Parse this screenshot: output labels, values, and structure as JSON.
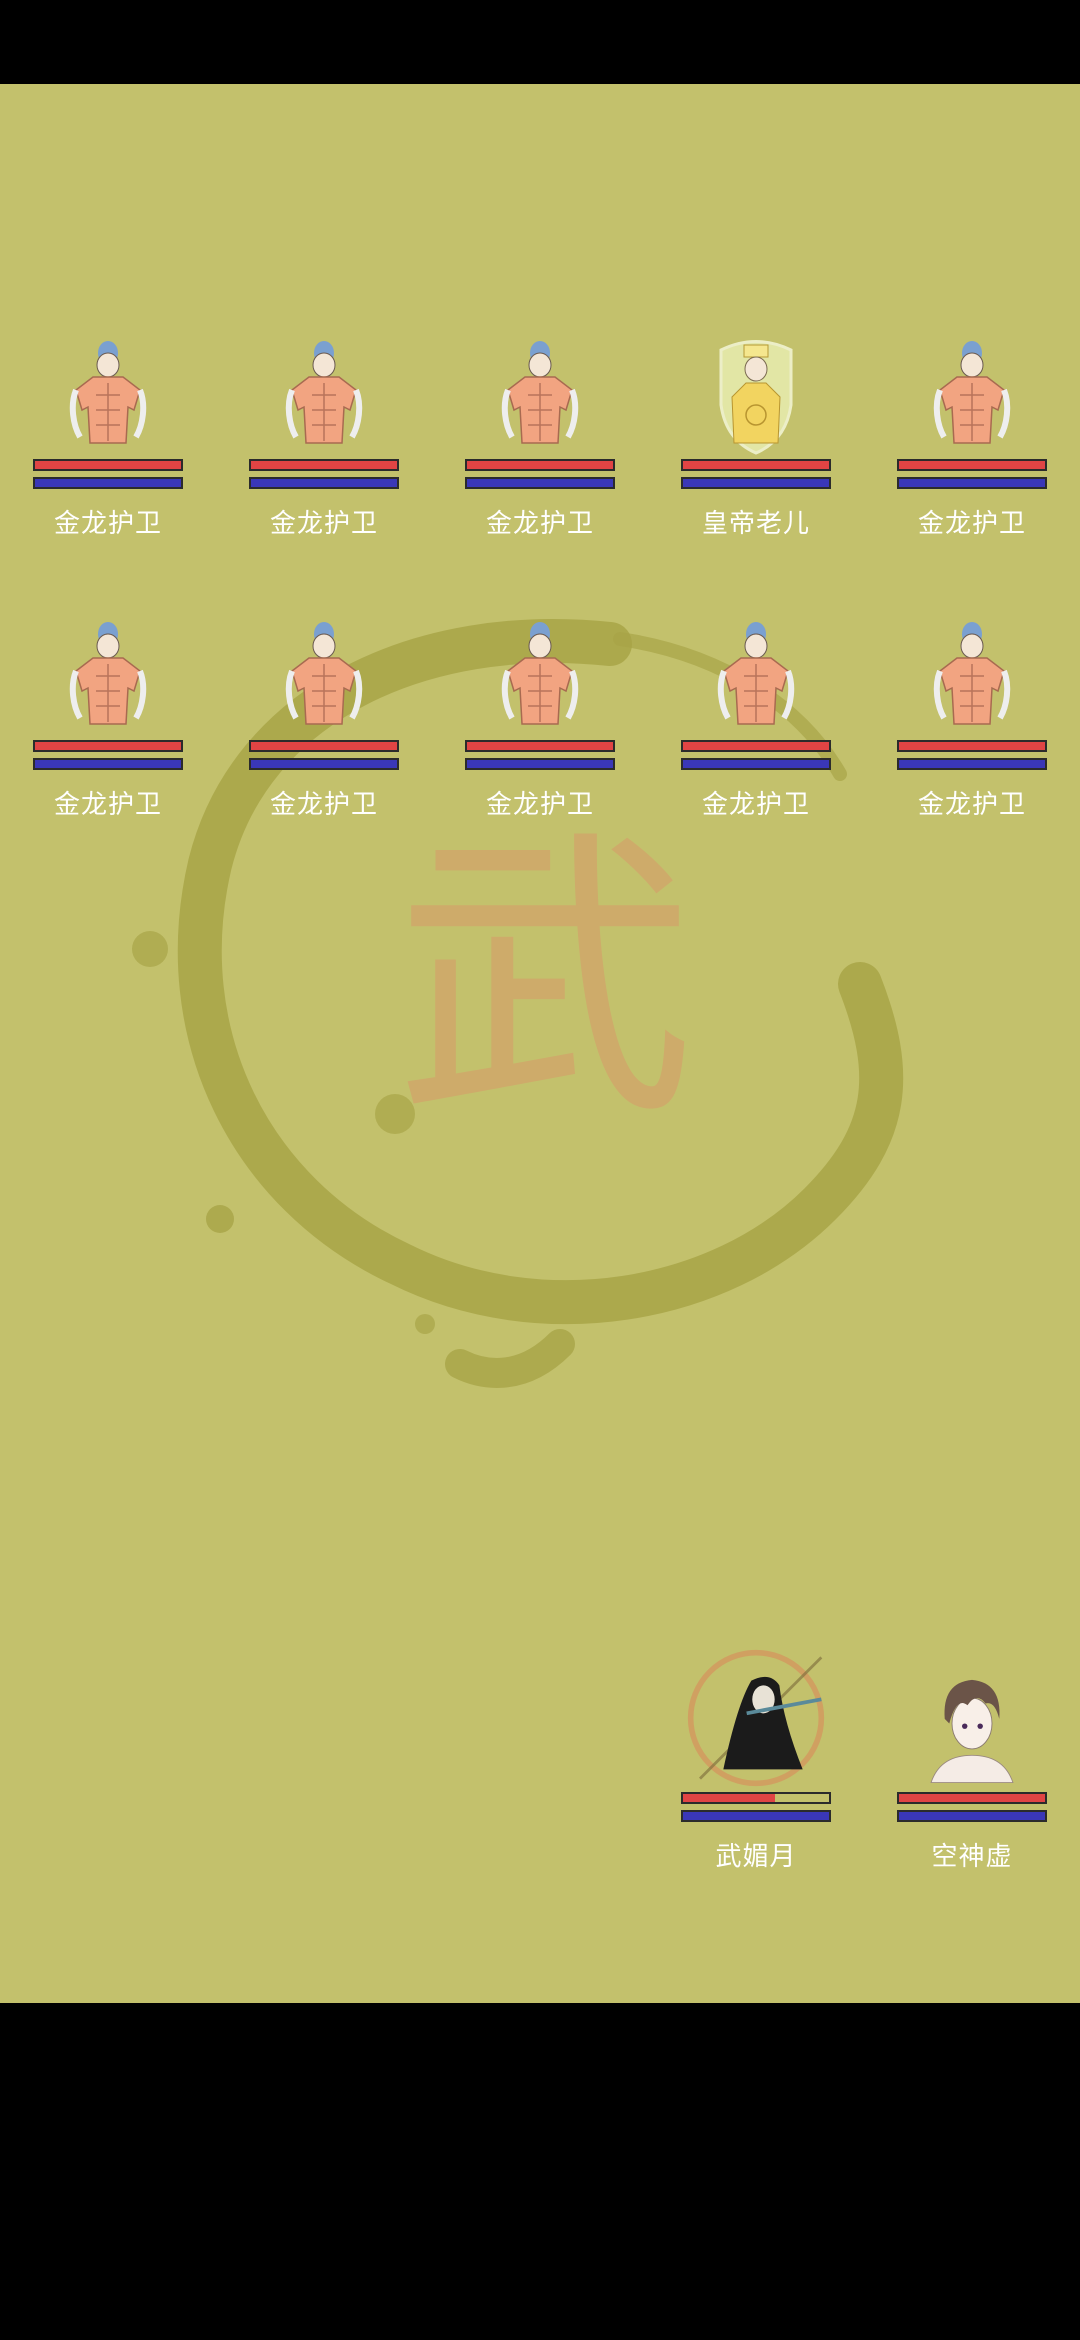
{
  "enemies_row1": [
    {
      "name": "金龙护卫",
      "hp": 1.0,
      "mp": 1.0,
      "portrait": "armored-guard"
    },
    {
      "name": "金龙护卫",
      "hp": 1.0,
      "mp": 1.0,
      "portrait": "armored-guard"
    },
    {
      "name": "金龙护卫",
      "hp": 1.0,
      "mp": 1.0,
      "portrait": "armored-guard"
    },
    {
      "name": "皇帝老儿",
      "hp": 1.0,
      "mp": 1.0,
      "portrait": "emperor-shielded"
    },
    {
      "name": "金龙护卫",
      "hp": 1.0,
      "mp": 1.0,
      "portrait": "armored-guard"
    }
  ],
  "enemies_row2": [
    {
      "name": "金龙护卫",
      "hp": 1.0,
      "mp": 1.0,
      "portrait": "armored-guard"
    },
    {
      "name": "金龙护卫",
      "hp": 1.0,
      "mp": 1.0,
      "portrait": "armored-guard"
    },
    {
      "name": "金龙护卫",
      "hp": 1.0,
      "mp": 1.0,
      "portrait": "armored-guard"
    },
    {
      "name": "金龙护卫",
      "hp": 1.0,
      "mp": 1.0,
      "portrait": "armored-guard"
    },
    {
      "name": "金龙护卫",
      "hp": 1.0,
      "mp": 1.0,
      "portrait": "armored-guard"
    }
  ],
  "allies": [
    {
      "name": "武媚月",
      "hp": 0.63,
      "mp": 1.0,
      "portrait": "flute-player"
    },
    {
      "name": "空神虚",
      "hp": 1.0,
      "mp": 1.0,
      "portrait": "brown-haired-youth"
    }
  ],
  "background_glyph": "武",
  "colors": {
    "field": "#c3c16c",
    "hp": "#e04444",
    "mp": "#3a37b8",
    "ink": "#a8a447",
    "glyph": "#d79a6a"
  }
}
